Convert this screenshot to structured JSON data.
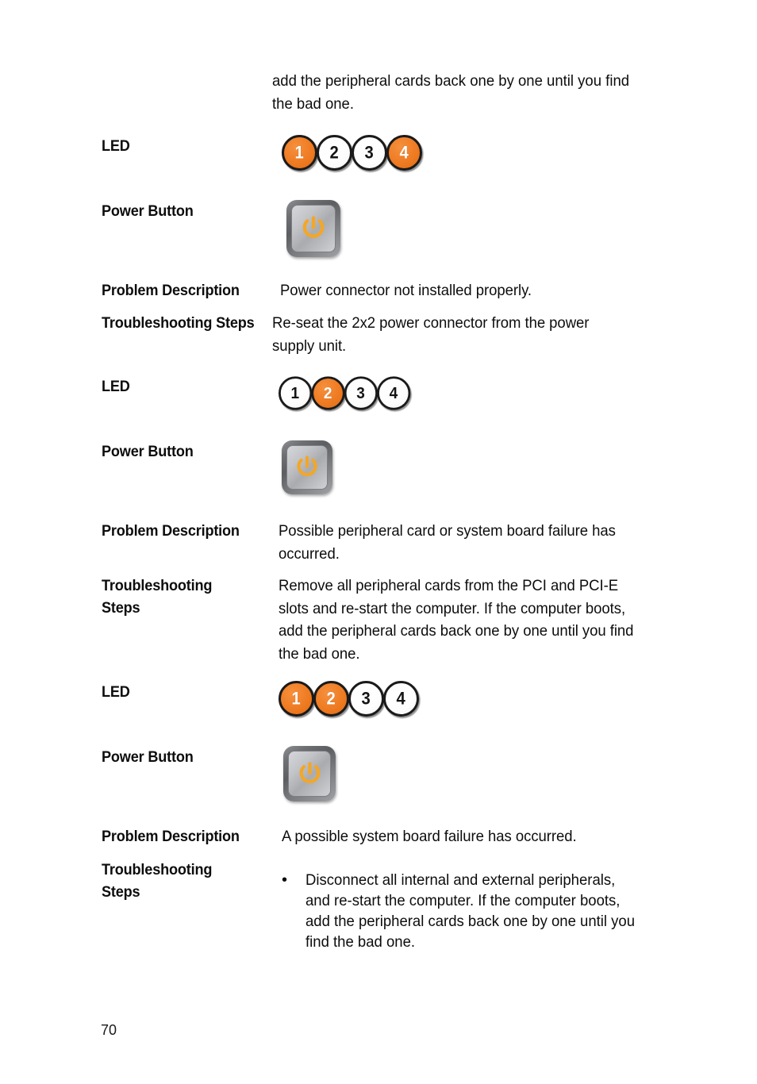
{
  "document": {
    "page_number": "70",
    "continuation_paragraph": "add the peripheral cards back one by one until you find\nthe bad one.",
    "labels": {
      "led": "LED",
      "power_button": "Power Button",
      "problem_description": "Problem Description",
      "troubleshooting_steps": "Troubleshooting Steps",
      "troubleshooting_steps_wrapped": "Troubleshooting\nSteps"
    },
    "colors": {
      "led_on": "#ef7b22",
      "led_off": "#ffffff",
      "led_border": "#1a1a1a",
      "power_icon": "#f5a623",
      "text": "#0d0d0d"
    },
    "icons": {
      "led_indicator": "led-indicator-icon",
      "power_button": "power-button-icon",
      "bullet": "bullet-dot-icon"
    }
  },
  "sections": [
    {
      "id": "section-1",
      "led_label": "LED",
      "leds": [
        {
          "number": "1",
          "state": "on"
        },
        {
          "number": "2",
          "state": "off"
        },
        {
          "number": "3",
          "state": "off"
        },
        {
          "number": "4",
          "state": "on"
        }
      ],
      "power_button_label": "Power Button",
      "power_button_state": "on",
      "problem_description_label": "Problem Description",
      "problem_description": "Power connector not installed properly.",
      "troubleshooting_label": "Troubleshooting Steps",
      "troubleshooting_text": "Re-seat the 2x2 power connector from the power\n supply unit."
    },
    {
      "id": "section-2",
      "led_label": "LED",
      "leds": [
        {
          "number": "1",
          "state": "off"
        },
        {
          "number": "2",
          "state": "on"
        },
        {
          "number": "3",
          "state": "off"
        },
        {
          "number": "4",
          "state": "off"
        }
      ],
      "power_button_label": "Power Button",
      "power_button_state": "on",
      "problem_description_label": "Problem Description",
      "problem_description": "Possible peripheral card or system board failure has\noccurred.",
      "troubleshooting_label": "Troubleshooting\nSteps",
      "troubleshooting_text": "Remove all peripheral cards from the PCI and PCI-E\nslots and re-start the computer. If the computer boots,\nadd the peripheral cards back one by one until you find\nthe bad one."
    },
    {
      "id": "section-3",
      "led_label": "LED",
      "leds": [
        {
          "number": "1",
          "state": "on"
        },
        {
          "number": "2",
          "state": "on"
        },
        {
          "number": "3",
          "state": "off"
        },
        {
          "number": "4",
          "state": "off"
        }
      ],
      "power_button_label": "Power Button",
      "power_button_state": "on",
      "problem_description_label": "Problem Description",
      "problem_description": "A possible system board failure has occurred.",
      "troubleshooting_label": "Troubleshooting\nSteps",
      "troubleshooting_bullets": [
        {
          "marker": "•",
          "text": "Disconnect all internal and external peripherals,\nand re-start the computer. If the computer boots,\nadd the peripheral cards back one by one until you\nfind the bad one."
        }
      ]
    }
  ]
}
